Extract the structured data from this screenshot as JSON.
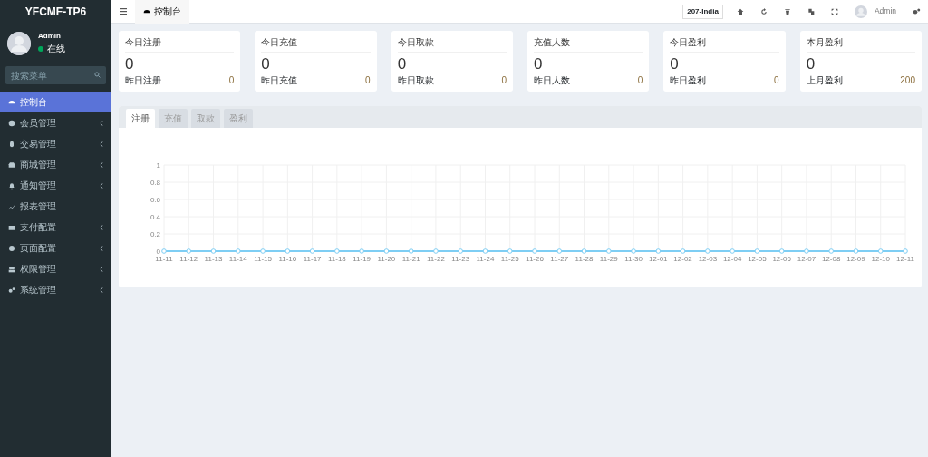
{
  "sidebar": {
    "brand": "YFCMF-TP6",
    "user": {
      "name": "Admin",
      "status": "在线",
      "online": true
    },
    "search": {
      "placeholder": "搜索菜单"
    },
    "items": [
      {
        "label": "控制台",
        "selected": true,
        "expandable": false
      },
      {
        "label": "会员管理",
        "selected": false,
        "expandable": true
      },
      {
        "label": "交易管理",
        "selected": false,
        "expandable": true
      },
      {
        "label": "商城管理",
        "selected": false,
        "expandable": true
      },
      {
        "label": "通知管理",
        "selected": false,
        "expandable": true
      },
      {
        "label": "报表管理",
        "selected": false,
        "expandable": false
      },
      {
        "label": "支付配置",
        "selected": false,
        "expandable": true
      },
      {
        "label": "页面配置",
        "selected": false,
        "expandable": true
      },
      {
        "label": "权限管理",
        "selected": false,
        "expandable": true
      },
      {
        "label": "系统管理",
        "selected": false,
        "expandable": true
      }
    ]
  },
  "topbar": {
    "tab": "控制台",
    "badge": "207-India",
    "user": "Admin"
  },
  "stats": [
    {
      "title": "今日注册",
      "value": "0",
      "sub_label": "昨日注册",
      "sub_value": "0"
    },
    {
      "title": "今日充值",
      "value": "0",
      "sub_label": "昨日充值",
      "sub_value": "0"
    },
    {
      "title": "今日取款",
      "value": "0",
      "sub_label": "昨日取款",
      "sub_value": "0"
    },
    {
      "title": "充值人数",
      "value": "0",
      "sub_label": "昨日人数",
      "sub_value": "0"
    },
    {
      "title": "今日盈利",
      "value": "0",
      "sub_label": "昨日盈利",
      "sub_value": "0"
    },
    {
      "title": "本月盈利",
      "value": "0",
      "sub_label": "上月盈利",
      "sub_value": "200"
    }
  ],
  "chart_tabs": [
    {
      "label": "注册",
      "selected": true
    },
    {
      "label": "充值",
      "selected": false
    },
    {
      "label": "取款",
      "selected": false
    },
    {
      "label": "盈利",
      "selected": false
    }
  ],
  "chart_data": {
    "type": "line",
    "categories": [
      "11-11",
      "11-12",
      "11-13",
      "11-14",
      "11-15",
      "11-16",
      "11-17",
      "11-18",
      "11-19",
      "11-20",
      "11-21",
      "11-22",
      "11-23",
      "11-24",
      "11-25",
      "11-26",
      "11-27",
      "11-28",
      "11-29",
      "11-30",
      "12-01",
      "12-02",
      "12-03",
      "12-04",
      "12-05",
      "12-06",
      "12-07",
      "12-08",
      "12-09",
      "12-10",
      "12-11"
    ],
    "grid": true,
    "series": [
      {
        "color": "#7ecef4",
        "marker": true,
        "values": [
          0,
          0,
          0,
          0,
          0,
          0,
          0,
          0,
          0,
          0,
          0,
          0,
          0,
          0,
          0,
          0,
          0,
          0,
          0,
          0,
          0,
          0,
          0,
          0,
          0,
          0,
          0,
          0,
          0,
          0,
          0
        ]
      }
    ],
    "ylim": [
      0,
      1
    ],
    "yticks": [
      0,
      0.2,
      0.4,
      0.6,
      0.8,
      1
    ]
  }
}
